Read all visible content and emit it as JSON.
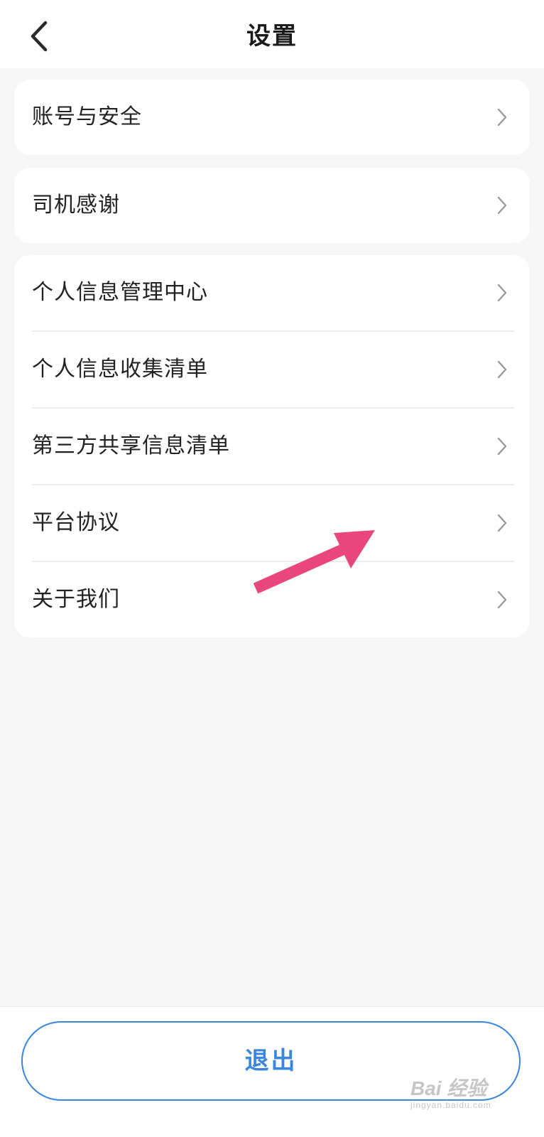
{
  "header": {
    "title": "设置",
    "back_icon": "chevron-left-icon"
  },
  "groups": [
    {
      "items": [
        {
          "label": "账号与安全"
        }
      ]
    },
    {
      "items": [
        {
          "label": "司机感谢"
        }
      ]
    },
    {
      "items": [
        {
          "label": "个人信息管理中心"
        },
        {
          "label": "个人信息收集清单"
        },
        {
          "label": "第三方共享信息清单"
        },
        {
          "label": "平台协议"
        },
        {
          "label": "关于我们"
        }
      ]
    }
  ],
  "row_chevron_icon": "chevron-right-icon",
  "annotation": {
    "icon": "pink-arrow-icon",
    "color": "#e8467c"
  },
  "footer": {
    "logout_label": "退出"
  },
  "watermark": {
    "text": "Bai 经验",
    "sub": "jingyan.baidu.com"
  },
  "colors": {
    "accent": "#3a86dd",
    "background": "#f7f7f7",
    "card": "#ffffff"
  }
}
